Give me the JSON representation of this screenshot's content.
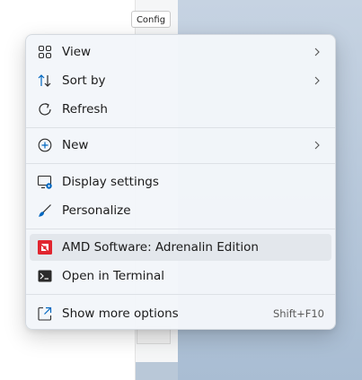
{
  "background_window": {
    "config_button_label": "Config"
  },
  "menu": {
    "items": [
      {
        "label": "View",
        "icon": "view-grid-icon",
        "submenu": true
      },
      {
        "label": "Sort by",
        "icon": "sort-icon",
        "submenu": true
      },
      {
        "label": "Refresh",
        "icon": "refresh-icon",
        "submenu": false
      },
      {
        "label": "New",
        "icon": "new-plus-icon",
        "submenu": true
      },
      {
        "label": "Display settings",
        "icon": "display-settings-icon",
        "submenu": false
      },
      {
        "label": "Personalize",
        "icon": "personalize-brush-icon",
        "submenu": false
      },
      {
        "label": "AMD Software: Adrenalin Edition",
        "icon": "amd-logo-icon",
        "submenu": false,
        "highlighted": true
      },
      {
        "label": "Open in Terminal",
        "icon": "terminal-icon",
        "submenu": false
      },
      {
        "label": "Show more options",
        "icon": "show-more-options-icon",
        "submenu": false,
        "shortcut": "Shift+F10"
      }
    ]
  },
  "colors": {
    "accent": "#0067c0",
    "amd_red": "#e1252f",
    "highlight": "#e3e7ec"
  }
}
